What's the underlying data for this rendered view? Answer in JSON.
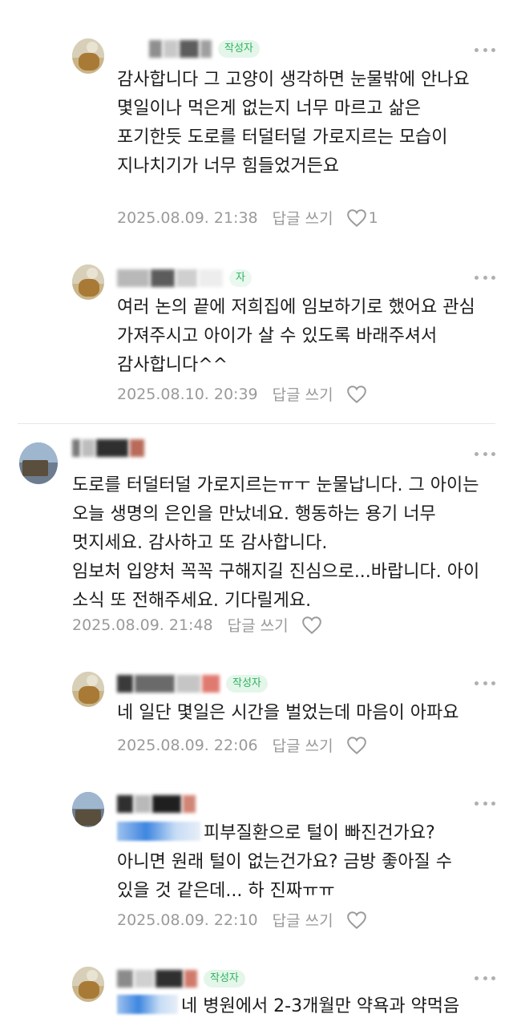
{
  "badge_author": "작성자",
  "badge_partial": "자",
  "reply_label": "답글 쓰기",
  "comments": [
    {
      "text": "감사합니다 그 고양이 생각하면 눈물밖에 안나요\n몇일이나 먹은게 없는지 너무 마르고 삶은\n포기한듯 도로를 터덜터덜 가로지르는 모습이\n지나치기가 너무 힘들었거든요",
      "date": "2025.08.09. 21:38",
      "likes": "1"
    },
    {
      "text": "여러 논의 끝에 저희집에 임보하기로 했어요 관심\n가져주시고 아이가 살 수 있도록 바래주셔서\n감사합니다^^",
      "date": "2025.08.10. 20:39"
    },
    {
      "text": "도로를 터덜터덜 가로지르는ㅠㅜ 눈물납니다. 그 아이는\n오늘 생명의 은인을 만났네요. 행동하는 용기 너무\n멋지세요. 감사하고 또 감사합니다.\n임보처 입양처 꼭꼭 구해지길 진심으로...바랍니다. 아이\n소식 또 전해주세요. 기다릴게요.",
      "date": "2025.08.09. 21:48"
    },
    {
      "text": "네 일단 몇일은 시간을 벌었는데 마음이 아파요",
      "date": "2025.08.09. 22:06"
    },
    {
      "text_after_mention": "피부질환으로 털이 빠진건가요?",
      "text_rest": "아니면 원래 털이 없는건가요? 금방 좋아질 수\n있을 것 같은데... 하 진짜ㅠㅠ",
      "date": "2025.08.09. 22:10"
    },
    {
      "text_after_mention": "네 병원에서 2-3개월만 약욕과 약먹음"
    }
  ]
}
